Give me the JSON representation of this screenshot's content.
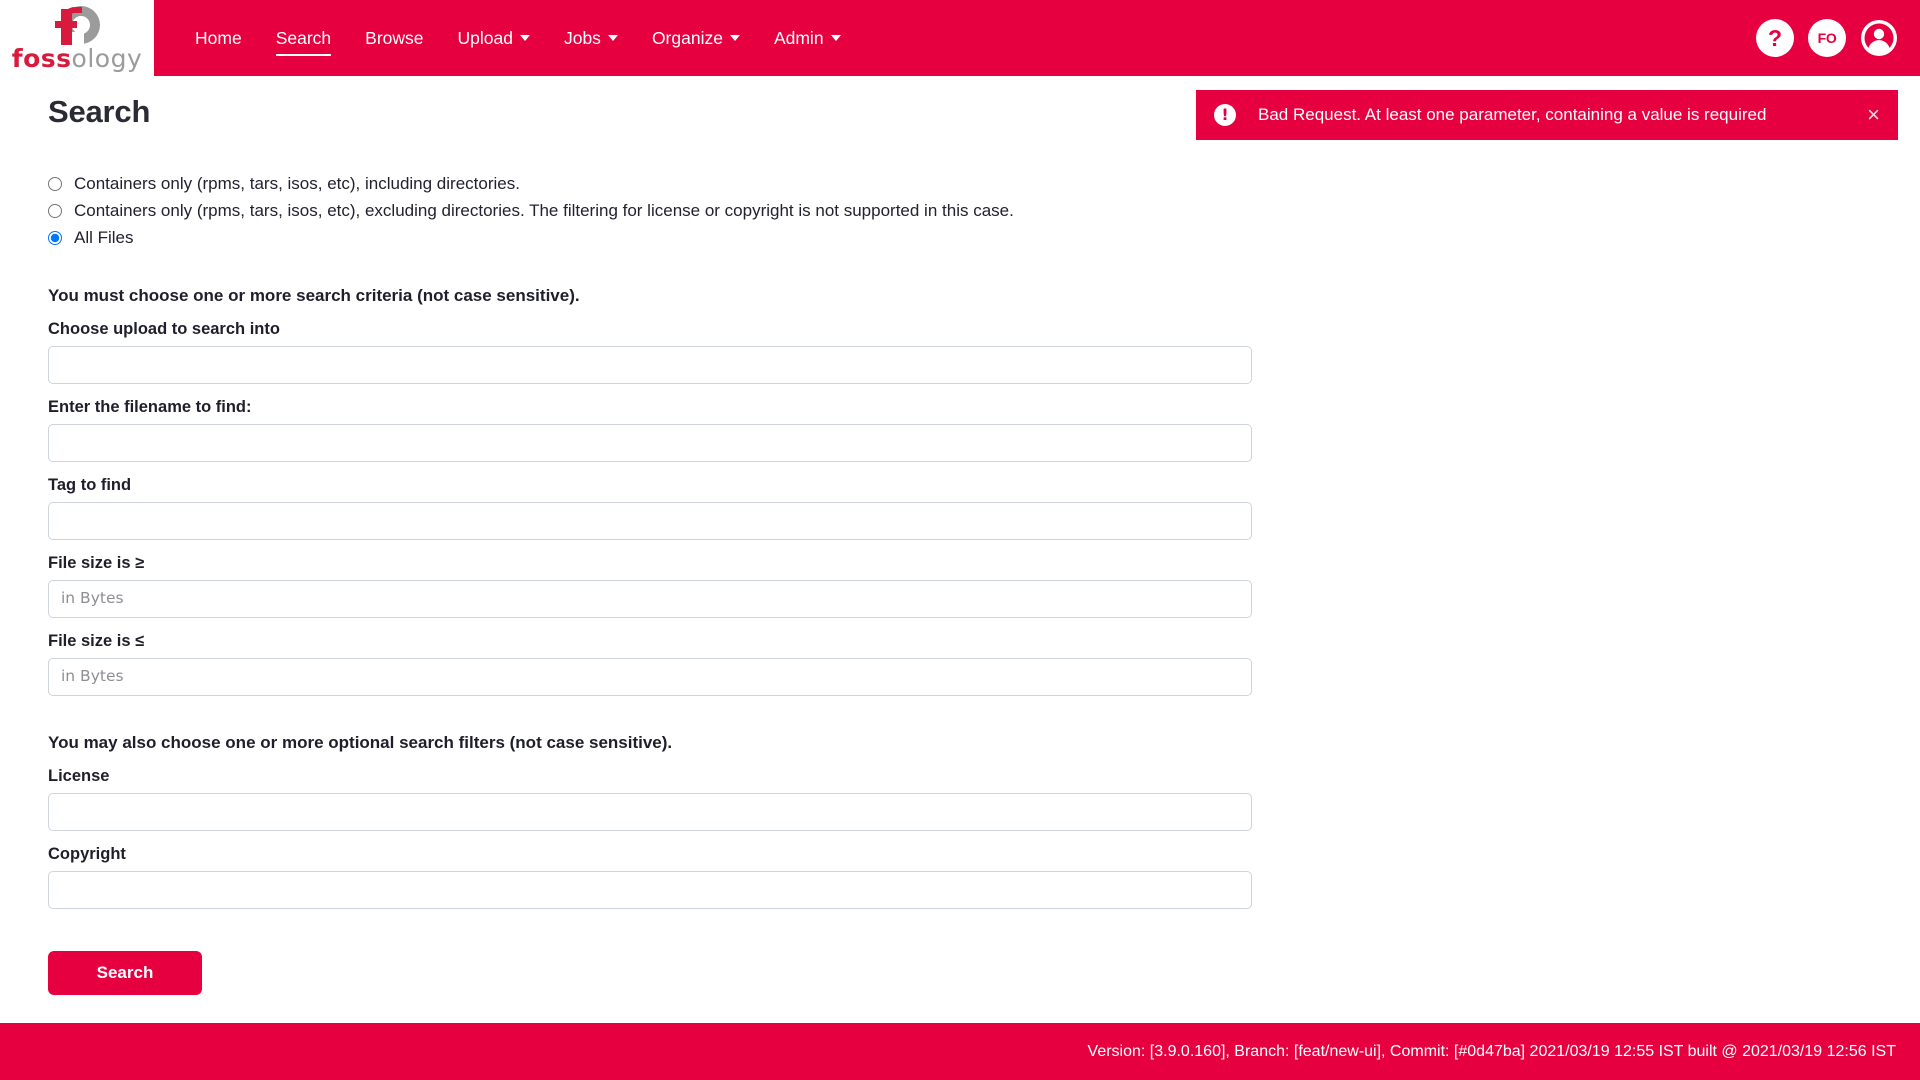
{
  "brand": {
    "name_part_1": "foss",
    "name_part_2": "ology",
    "logo_icon": "fossology-logo-icon"
  },
  "nav": {
    "items": [
      {
        "label": "Home",
        "has_caret": false,
        "active": false
      },
      {
        "label": "Search",
        "has_caret": false,
        "active": true
      },
      {
        "label": "Browse",
        "has_caret": false,
        "active": false
      },
      {
        "label": "Upload",
        "has_caret": true,
        "active": false
      },
      {
        "label": "Jobs",
        "has_caret": true,
        "active": false
      },
      {
        "label": "Organize",
        "has_caret": true,
        "active": false
      },
      {
        "label": "Admin",
        "has_caret": true,
        "active": false
      }
    ],
    "help_label": "?",
    "org_label": "FO",
    "user_icon": "user-avatar-icon"
  },
  "alert": {
    "icon": "exclamation-circle-icon",
    "message": "Bad Request. At least one parameter, containing a value is required",
    "close_label": "×"
  },
  "page": {
    "title": "Search"
  },
  "radio_options": [
    {
      "label": "Containers only (rpms, tars, isos, etc), including directories.",
      "checked": false
    },
    {
      "label": "Containers only (rpms, tars, isos, etc), excluding directories. The filtering for license or copyright is not supported in this case.",
      "checked": false
    },
    {
      "label": "All Files",
      "checked": true
    }
  ],
  "criteria": {
    "note": "You must choose one or more search criteria (not case sensitive).",
    "fields": [
      {
        "label": "Choose upload to search into",
        "value": "",
        "placeholder": ""
      },
      {
        "label": "Enter the filename to find:",
        "value": "",
        "placeholder": ""
      },
      {
        "label": "Tag to find",
        "value": "",
        "placeholder": ""
      },
      {
        "label": "File size is ≥",
        "value": "",
        "placeholder": "in Bytes"
      },
      {
        "label": "File size is ≤",
        "value": "",
        "placeholder": "in Bytes"
      }
    ]
  },
  "filters": {
    "note": "You may also choose one or more optional search filters (not case sensitive).",
    "fields": [
      {
        "label": "License",
        "value": "",
        "placeholder": ""
      },
      {
        "label": "Copyright",
        "value": "",
        "placeholder": ""
      }
    ]
  },
  "submit": {
    "label": "Search"
  },
  "footer": {
    "text": "Version: [3.9.0.160], Branch: [feat/new-ui], Commit: [#0d47ba] 2021/03/19 12:55 IST built @ 2021/03/19 12:56 IST"
  },
  "colors": {
    "brand_red": "#e60040",
    "logo_red": "#d81b3c",
    "logo_gray": "#9b9b9b",
    "text_dark": "#1f1f2b",
    "input_border": "#ced4da",
    "radio_accent": "#2a3aeb"
  }
}
